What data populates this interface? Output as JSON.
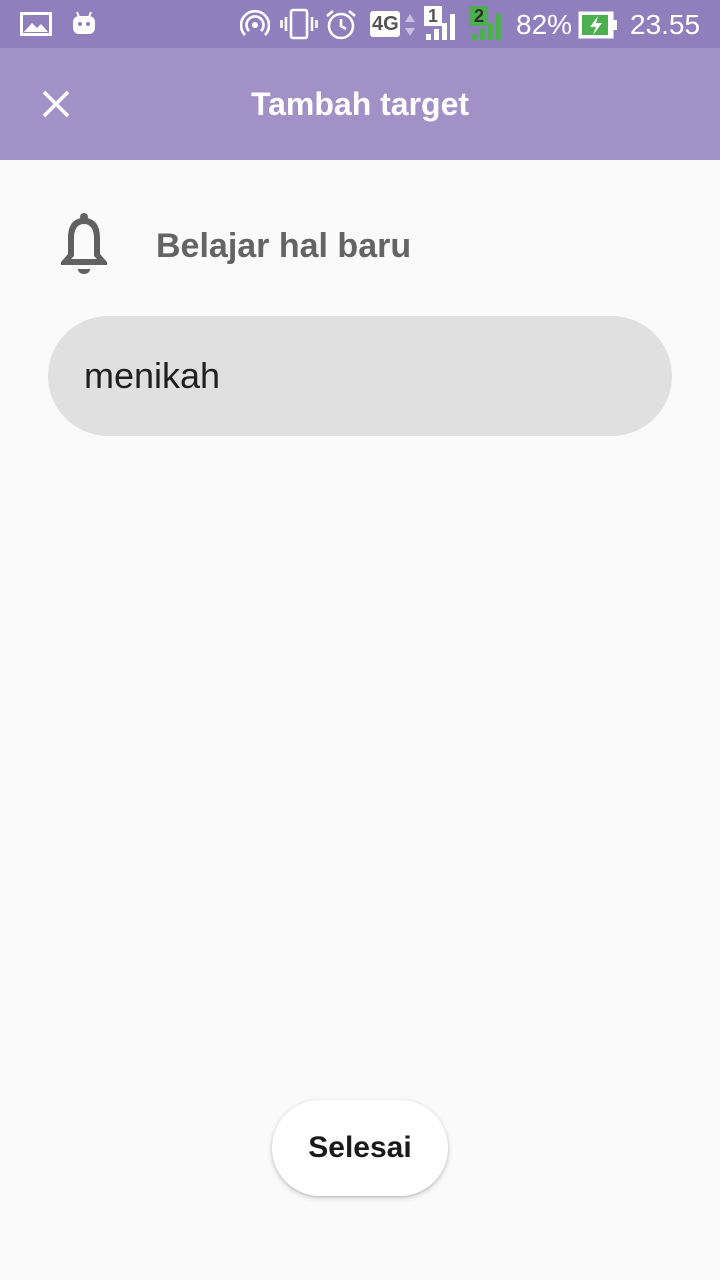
{
  "status_bar": {
    "network_type": "4G",
    "sim1_label": "1",
    "sim2_label": "2",
    "battery_percent": "82%",
    "time": "23.55"
  },
  "app_bar": {
    "title": "Tambah target",
    "close_icon": "close-icon"
  },
  "category": {
    "icon": "bell-icon",
    "label": "Belajar hal baru"
  },
  "goal_input": {
    "value": "menikah"
  },
  "footer": {
    "done_label": "Selesai"
  },
  "colors": {
    "status_bar": "#8f7fbd",
    "app_bar": "#a291c6",
    "background": "#fafafa",
    "input_bg": "#e0e0e0"
  }
}
